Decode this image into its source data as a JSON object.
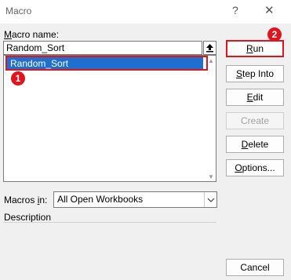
{
  "window": {
    "title": "Macro",
    "help_glyph": "?",
    "close_glyph": "✕"
  },
  "macro_name": {
    "label_first": "M",
    "label_rest": "acro name:",
    "value": "Random_Sort"
  },
  "macro_list": {
    "items": [
      "Random_Sort"
    ],
    "selected": "Random_Sort"
  },
  "buttons": {
    "run": {
      "mnemonic": "R",
      "rest": "un"
    },
    "step_into": {
      "mnemonic": "S",
      "rest": "tep Into"
    },
    "edit": {
      "mnemonic": "E",
      "rest": "dit"
    },
    "create": "Create",
    "delete": {
      "mnemonic": "D",
      "rest": "elete"
    },
    "options": {
      "mnemonic": "O",
      "rest": "ptions..."
    },
    "cancel": "Cancel"
  },
  "macros_in": {
    "label_first": "Macros ",
    "label_mnemonic": "i",
    "label_rest": "n:",
    "value": "All Open Workbooks"
  },
  "description_label": "Description",
  "annotations": {
    "badge1": "1",
    "badge2": "2",
    "color": "#e0141e"
  },
  "colors": {
    "selection": "#1f6fcf"
  }
}
